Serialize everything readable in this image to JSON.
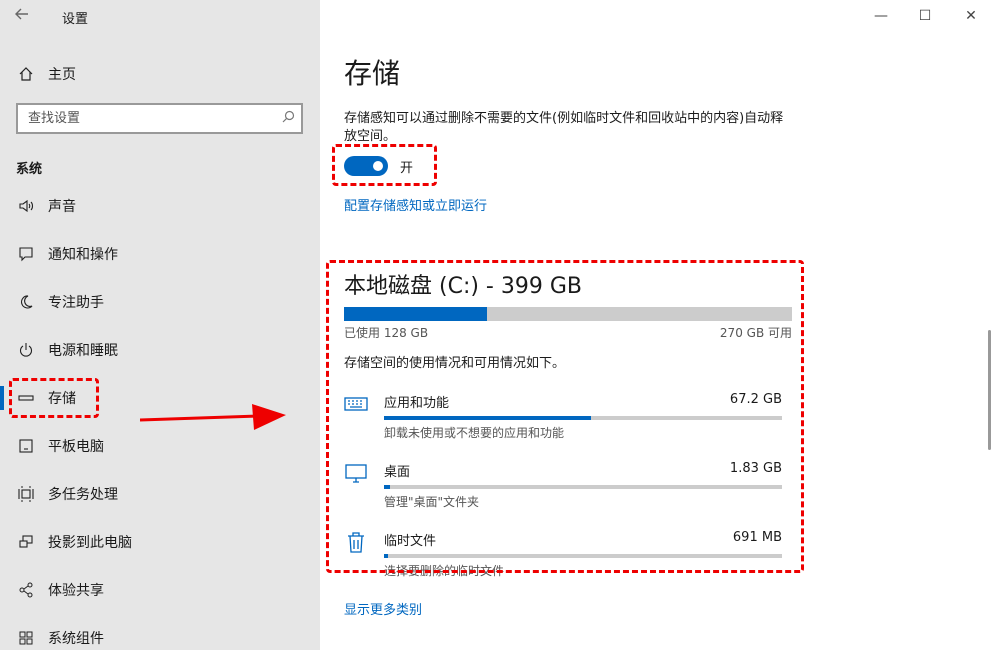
{
  "window": {
    "title": "设置",
    "accent": "#0067c0",
    "annotation_color": "#e00000"
  },
  "sidebar": {
    "home": "主页",
    "search_placeholder": "查找设置",
    "section": "系统",
    "items": [
      {
        "label": "声音",
        "icon": "speaker-icon"
      },
      {
        "label": "通知和操作",
        "icon": "message-icon"
      },
      {
        "label": "专注助手",
        "icon": "moon-icon"
      },
      {
        "label": "电源和睡眠",
        "icon": "power-icon"
      },
      {
        "label": "存储",
        "icon": "storage-icon",
        "active": true
      },
      {
        "label": "平板电脑",
        "icon": "tablet-icon"
      },
      {
        "label": "多任务处理",
        "icon": "multitask-icon"
      },
      {
        "label": "投影到此电脑",
        "icon": "project-icon"
      },
      {
        "label": "体验共享",
        "icon": "share-icon"
      },
      {
        "label": "系统组件",
        "icon": "components-icon"
      }
    ]
  },
  "main": {
    "title": "存储",
    "description": "存储感知可以通过删除不需要的文件(例如临时文件和回收站中的内容)自动释放空间。",
    "toggle_state": "开",
    "configure_link": "配置存储感知或立即运行",
    "disk": {
      "title": "本地磁盘 (C:) - 399 GB",
      "used": "已使用 128 GB",
      "free": "270 GB 可用",
      "used_fraction": 0.32,
      "description": "存储空间的使用情况和可用情况如下。",
      "categories": [
        {
          "name": "应用和功能",
          "size": "67.2 GB",
          "sub": "卸载未使用或不想要的应用和功能",
          "fraction": 0.52,
          "icon": "keyboard-icon"
        },
        {
          "name": "桌面",
          "size": "1.83 GB",
          "sub": "管理\"桌面\"文件夹",
          "fraction": 0.015,
          "icon": "monitor-icon"
        },
        {
          "name": "临时文件",
          "size": "691 MB",
          "sub": "选择要删除的临时文件",
          "fraction": 0.006,
          "icon": "trash-icon"
        }
      ]
    },
    "more_link": "显示更多类别"
  }
}
